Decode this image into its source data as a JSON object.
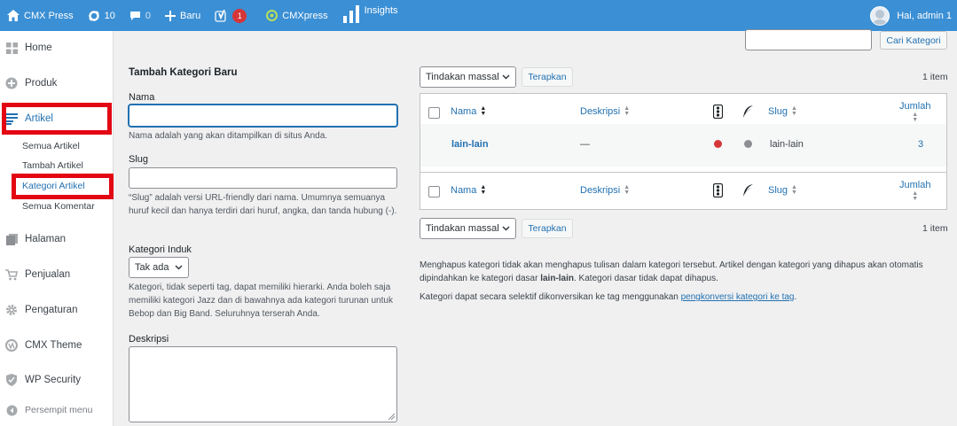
{
  "adminbar": {
    "site_name": "CMX Press",
    "updates_count": "10",
    "comments_count": "0",
    "new_label": "Baru",
    "plugin_badge": "1",
    "cmxpress_label": "CMXpress",
    "insights_label": "Insights",
    "greeting": "Hai, admin 1"
  },
  "sidebar": {
    "items": [
      {
        "label": "Home",
        "icon": "dashboard-icon"
      },
      {
        "label": "Produk",
        "icon": "plus-circle-icon"
      },
      {
        "label": "Artikel",
        "icon": "posts-icon"
      },
      {
        "label": "Halaman",
        "icon": "pages-icon"
      },
      {
        "label": "Penjualan",
        "icon": "cart-icon"
      },
      {
        "label": "Pengaturan",
        "icon": "gear-icon"
      },
      {
        "label": "CMX Theme",
        "icon": "theme-icon"
      },
      {
        "label": "WP Security",
        "icon": "shield-icon"
      },
      {
        "label": "Persempit menu",
        "icon": "collapse-icon"
      }
    ],
    "submenu": [
      "Semua Artikel",
      "Tambah Artikel",
      "Kategori Artikel",
      "Semua Komentar"
    ],
    "highlight_color": "#e30613"
  },
  "form": {
    "title": "Tambah Kategori Baru",
    "name_label": "Nama",
    "name_value": "",
    "name_help": "Nama adalah yang akan ditampilkan di situs Anda.",
    "slug_label": "Slug",
    "slug_value": "",
    "slug_help": "“Slug” adalah versi URL-friendly dari nama. Umumnya semuanya huruf kecil dan hanya terdiri dari huruf, angka, dan tanda hubung (-).",
    "parent_label": "Kategori Induk",
    "parent_value": "Tak ada",
    "parent_help": "Kategori, tidak seperti tag, dapat memiliki hierarki. Anda boleh saja memiliki kategori Jazz dan di bawahnya ada kategori turunan untuk Bebop dan Big Band. Seluruhnya terserah Anda.",
    "desc_label": "Deskripsi"
  },
  "search": {
    "button": "Cari Kategori",
    "value": ""
  },
  "bulk": {
    "select_value": "Tindakan massal",
    "apply": "Terapkan",
    "count": "1 item"
  },
  "table": {
    "columns": {
      "name": "Nama",
      "description": "Deskripsi",
      "slug": "Slug",
      "count": "Jumlah"
    },
    "rows": [
      {
        "name": "lain-lain",
        "description": "—",
        "status1_color": "#d63638",
        "status2_color": "#8c8f94",
        "slug": "lain-lain",
        "count": "3"
      }
    ]
  },
  "notes": {
    "p1_a": "Menghapus kategori tidak akan menghapus tulisan dalam kategori tersebut. Artikel dengan kategori yang dihapus akan otomatis dipindahkan ke kategori dasar ",
    "p1_b": "lain-lain",
    "p1_c": ". Kategori dasar tidak dapat dihapus.",
    "p2_a": "Kategori dapat secara selektif dikonversikan ke tag menggunakan ",
    "p2_link": "pengkonversi kategori ke tag",
    "p2_c": "."
  },
  "colors": {
    "adminbar": "#3b8fd4",
    "accent": "#2271b1"
  }
}
